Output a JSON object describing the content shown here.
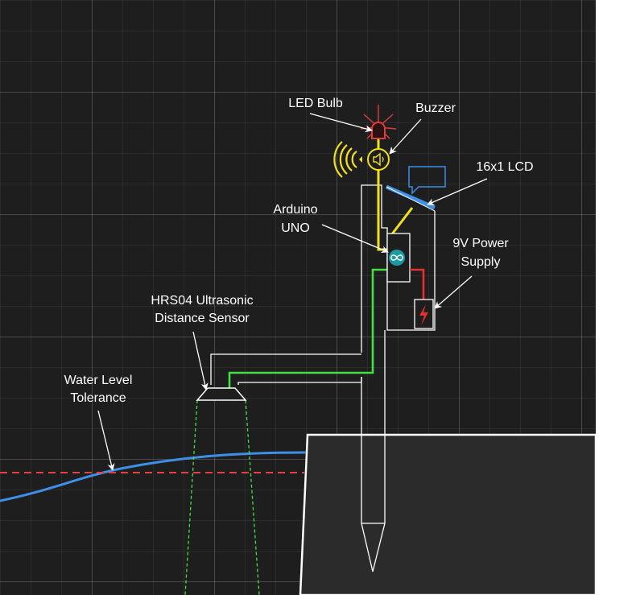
{
  "labels": {
    "led_bulb": "LED Bulb",
    "buzzer": "Buzzer",
    "lcd": "16x1 LCD",
    "arduino_line1": "Arduino",
    "arduino_line2": "UNO",
    "power_line1": "9V Power",
    "power_line2": "Supply",
    "sensor_line1": "HRS04 Ultrasonic",
    "sensor_line2": "Distance Sensor",
    "tolerance_line1": "Water Level",
    "tolerance_line2": "Tolerance"
  },
  "colors": {
    "background": "#1e1e1e",
    "outline": "#ffffff",
    "led": "#e03b3b",
    "buzzer": "#f2e01d",
    "lcd": "#3d8fe8",
    "arduino_logo": "#1d9aa0",
    "power_wire": "#e53030",
    "sensor_wire": "#43e043",
    "water_line": "#3d8fe8",
    "tolerance_line": "#e84040",
    "ground": "#2b2b2b"
  },
  "icons": {
    "led": "led-bulb-icon",
    "buzzer": "speaker-icon",
    "sound_waves": "sound-waves-icon",
    "speech_bubble": "speech-bubble-icon",
    "arduino": "arduino-infinity-icon",
    "battery": "lightning-bolt-icon"
  }
}
